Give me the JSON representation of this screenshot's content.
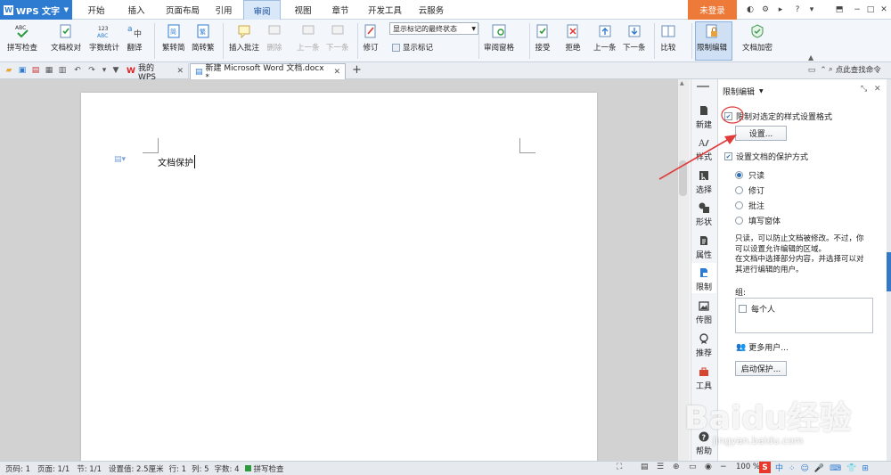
{
  "app": {
    "name": "WPS 文字"
  },
  "menu_tabs": [
    "开始",
    "插入",
    "页面布局",
    "引用",
    "审阅",
    "视图",
    "章节",
    "开发工具",
    "云服务"
  ],
  "login": "未登录",
  "ribbon": {
    "spell": "拼写检查",
    "doc_check": "文档校对",
    "word_count": "字数统计",
    "translate": "翻译",
    "to_simplified": "繁转简",
    "to_traditional": "简转繁",
    "insert_comment": "插入批注",
    "delete": "删除",
    "prev": "上一条",
    "next": "下一条",
    "revise": "修订",
    "show_state": "显示标记的最终状态",
    "show_markup": "显示标记",
    "review_pane": "审阅窗格",
    "accept": "接受",
    "reject": "拒绝",
    "prev2": "上一条",
    "next2": "下一条",
    "compare": "比较",
    "restrict": "限制编辑",
    "encrypt": "文档加密"
  },
  "doc_tabs": {
    "my_wps": "我的WPS",
    "current": "新建 Microsoft Word 文档.docx *",
    "add": "+"
  },
  "command_search": "点此查找命令",
  "document": {
    "text": "文档保护"
  },
  "side_items": [
    "新建",
    "样式",
    "选择",
    "形状",
    "属性",
    "限制",
    "传图",
    "推荐",
    "工具",
    "帮助"
  ],
  "pane": {
    "title": "限制编辑",
    "opt_format": "限制对选定的样式设置格式",
    "settings_btn": "设置...",
    "opt_protect": "设置文档的保护方式",
    "modes": [
      "只读",
      "修订",
      "批注",
      "填写窗体"
    ],
    "desc": [
      "只读，可以防止文档被修改。不过，你",
      "可以设置允许编辑的区域。",
      "在文档中选择部分内容，并选择可以对",
      "其进行编辑的用户。"
    ],
    "group_label": "组:",
    "everyone": "每个人",
    "more_users": "更多用户...",
    "start_btn": "启动保护..."
  },
  "status": {
    "page_code": "页码: 1",
    "pages": "页面: 1/1",
    "section": "节: 1/1",
    "setting": "设置值: 2.5厘米",
    "row": "行: 1",
    "col": "列: 5",
    "words": "字数: 4",
    "spell": "拼写检查",
    "zoom": "100 %"
  },
  "watermark": {
    "brand": "Baidu经验",
    "url": "jingyan.baidu.com"
  },
  "colors": {
    "accent": "#2e7cd1",
    "login": "#ee7a3a",
    "annotation": "#e03b3b"
  }
}
